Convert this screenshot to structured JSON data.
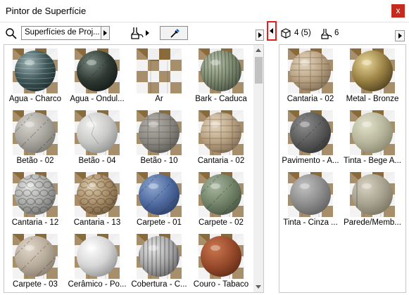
{
  "window": {
    "title": "Pintor de Superfície",
    "close_glyph": "x"
  },
  "toolbar": {
    "search_icon": "search-icon",
    "combo_value": "Superfícies de Proj...",
    "bucket_icon": "paint-bucket-icon",
    "eyedropper_icon": "eyedropper-icon"
  },
  "right_header": {
    "cube_icon": "cube-icon",
    "elements_count": "4 (5)",
    "bucket_icon": "paint-bucket-icon",
    "surfaces_count": "6"
  },
  "library": {
    "items": [
      {
        "label": "Água - Charco",
        "material": "water-dark"
      },
      {
        "label": "Água - Ondul...",
        "material": "water-green"
      },
      {
        "label": "Ar",
        "material": "air"
      },
      {
        "label": "Bark - Caduca",
        "material": "bark"
      },
      {
        "label": "Betão - 02",
        "material": "concrete-light"
      },
      {
        "label": "Betão - 04",
        "material": "concrete-white"
      },
      {
        "label": "Betão - 10",
        "material": "block-grey"
      },
      {
        "label": "Cantaria - 02",
        "material": "stone-tan"
      },
      {
        "label": "Cantaria - 12",
        "material": "stone-grey"
      },
      {
        "label": "Cantaria - 13",
        "material": "pebbles"
      },
      {
        "label": "Carpete - 01",
        "material": "carpet-blue"
      },
      {
        "label": "Carpete - 02",
        "material": "carpet-green"
      },
      {
        "label": "Carpete - 03",
        "material": "carpet-beige"
      },
      {
        "label": "Cerâmico - Po...",
        "material": "ceramic-white"
      },
      {
        "label": "Cobertura - C...",
        "material": "metal-ribbed"
      },
      {
        "label": "Couro - Tabaco",
        "material": "leather"
      }
    ]
  },
  "in_use": {
    "items": [
      {
        "label": "Cantaria - 02",
        "material": "stone-tan"
      },
      {
        "label": "Metal - Bronze",
        "material": "bronze"
      },
      {
        "label": "Pavimento - A...",
        "material": "asphalt"
      },
      {
        "label": "Tinta - Bege A...",
        "material": "paint-beige"
      },
      {
        "label": "Tinta - Cinza ...",
        "material": "paint-grey"
      },
      {
        "label": "Parede/Memb...",
        "material": "membrane"
      }
    ]
  },
  "colors": {
    "close_bg": "#c42b1c",
    "highlight_border": "#e02020",
    "checker_dark": "#8a6a3a",
    "checker_light": "#efefef"
  }
}
